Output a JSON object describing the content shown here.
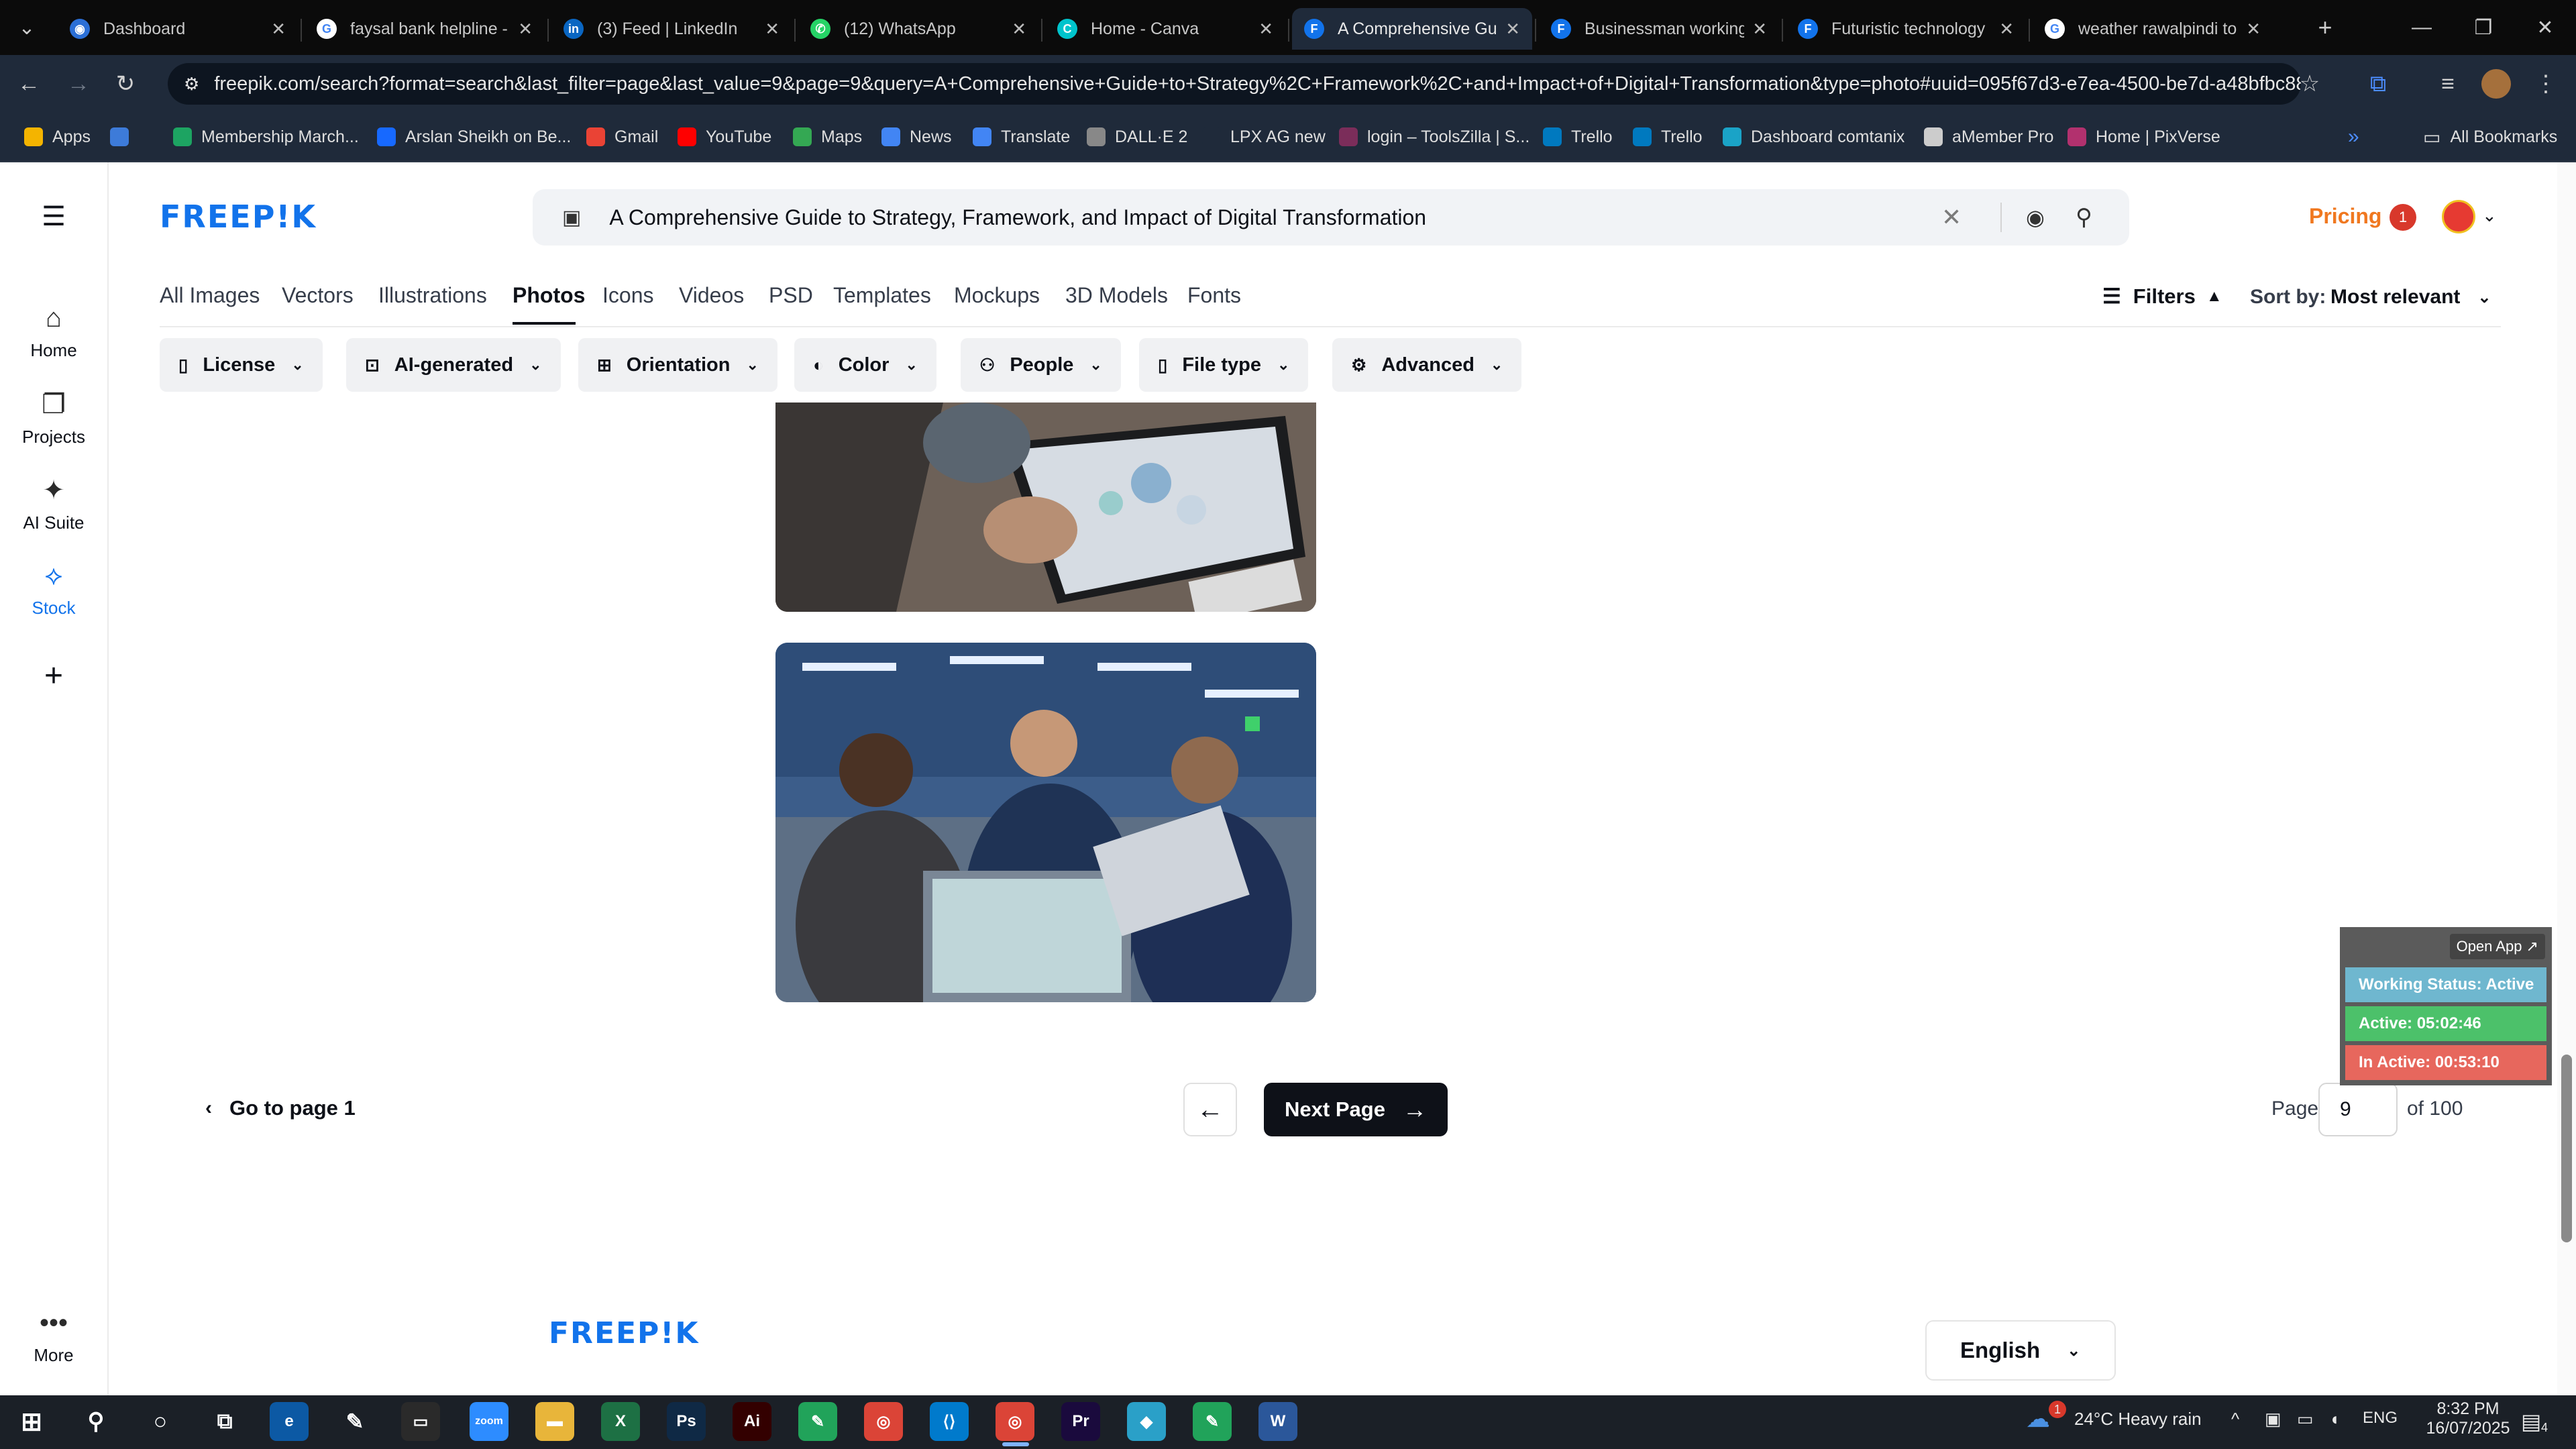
{
  "browser": {
    "tabs": [
      {
        "title": "Dashboard",
        "color": "#2b6fd6",
        "glyph": "◉"
      },
      {
        "title": "faysal bank helpline -",
        "color": "#ffffff",
        "glyph": "G"
      },
      {
        "title": "(3) Feed | LinkedIn",
        "color": "#0a66c2",
        "glyph": "in"
      },
      {
        "title": "(12) WhatsApp",
        "color": "#25d366",
        "glyph": "✆"
      },
      {
        "title": "Home - Canva",
        "color": "#00c4cc",
        "glyph": "C"
      },
      {
        "title": "A Comprehensive Gu",
        "color": "#1273eb",
        "glyph": "F"
      },
      {
        "title": "Businessman working",
        "color": "#1273eb",
        "glyph": "F"
      },
      {
        "title": "Futuristic technology",
        "color": "#1273eb",
        "glyph": "F"
      },
      {
        "title": "weather rawalpindi to",
        "color": "#ffffff",
        "glyph": "G"
      }
    ],
    "url": "freepik.com/search?format=search&last_filter=page&last_value=9&page=9&query=A+Comprehensive+Guide+to+Strategy%2C+Framework%2C+and+Impact+of+Digital+Transformation&type=photo#uuid=095f67d3-e7ea-4500-be7d-a48bfbc88e...",
    "bookmarks": [
      {
        "label": "Apps",
        "color": "#f4b400"
      },
      {
        "label": "",
        "color": "#3d7bd9"
      },
      {
        "label": "Membership March...",
        "color": "#1da462"
      },
      {
        "label": "Arslan Sheikh on Be...",
        "color": "#1769ff"
      },
      {
        "label": "Gmail",
        "color": "#ea4335"
      },
      {
        "label": "YouTube",
        "color": "#ff0000"
      },
      {
        "label": "Maps",
        "color": "#34a853"
      },
      {
        "label": "News",
        "color": "#4285f4"
      },
      {
        "label": "Translate",
        "color": "#4285f4"
      },
      {
        "label": "DALL·E 2",
        "color": "#888888"
      },
      {
        "label": "LPX AG new",
        "color": "#1f2a3a"
      },
      {
        "label": "login – ToolsZilla | S...",
        "color": "#7b2d5a"
      },
      {
        "label": "Trello",
        "color": "#0079bf"
      },
      {
        "label": "Trello",
        "color": "#0079bf"
      },
      {
        "label": "Dashboard comtanix",
        "color": "#1aa3c7"
      },
      {
        "label": "aMember Pro",
        "color": "#cccccc"
      },
      {
        "label": "Home | PixVerse",
        "color": "#b2316e"
      }
    ],
    "all_bookmarks": "All Bookmarks"
  },
  "freepik": {
    "logo": "FREEP!K",
    "rail": [
      {
        "label": "Home",
        "icon": "⌂"
      },
      {
        "label": "Projects",
        "icon": "❐"
      },
      {
        "label": "AI Suite",
        "icon": "✦"
      },
      {
        "label": "Stock",
        "icon": "⟡"
      }
    ],
    "rail_add": "+",
    "rail_more": "More",
    "search_value": "A Comprehensive Guide to Strategy, Framework, and Impact of Digital Transformation",
    "pricing": "Pricing",
    "notif_count": "1",
    "categories": [
      "All Images",
      "Vectors",
      "Illustrations",
      "Photos",
      "Icons",
      "Videos",
      "PSD",
      "Templates",
      "Mockups",
      "3D Models",
      "Fonts"
    ],
    "filters_label": "Filters",
    "sort_label": "Sort by:",
    "sort_value": "Most relevant",
    "filter_buttons": [
      "License",
      "AI-generated",
      "Orientation",
      "Color",
      "People",
      "File type",
      "Advanced"
    ],
    "go_to_page1": "Go to page 1",
    "next_page": "Next Page",
    "page_label": "Page",
    "page_value": "9",
    "page_of": "of 100",
    "language": "English",
    "footer_logo": "FREEP!K"
  },
  "widget": {
    "open_app": "Open App ↗",
    "status": "Working Status: Active",
    "active": "Active: 05:02:46",
    "inactive": "In Active: 00:53:10",
    "colors": {
      "status": "#6fb7cf",
      "active": "#4cc16a",
      "inactive": "#e7675d"
    }
  },
  "taskbar": {
    "apps": [
      {
        "name": "zoom",
        "label": "zoom",
        "color": "#2d8cff"
      },
      {
        "name": "file-explorer",
        "label": "▬",
        "color": "#e8b53a"
      },
      {
        "name": "excel",
        "label": "X",
        "color": "#1d7044"
      },
      {
        "name": "photoshop",
        "label": "Ps",
        "color": "#0f2945"
      },
      {
        "name": "illustrator",
        "label": "Ai",
        "color": "#330000"
      },
      {
        "name": "app-green-1",
        "label": "✎",
        "color": "#21a35a"
      },
      {
        "name": "chrome",
        "label": "◎",
        "color": "#db4437"
      },
      {
        "name": "vscode",
        "label": "⟨⟩",
        "color": "#007acc"
      },
      {
        "name": "chrome-active",
        "label": "◎",
        "color": "#db4437"
      },
      {
        "name": "premiere",
        "label": "Pr",
        "color": "#1a0a3d"
      },
      {
        "name": "app-blue",
        "label": "◆",
        "color": "#2aa0c8"
      },
      {
        "name": "app-green-2",
        "label": "✎",
        "color": "#21a35a"
      },
      {
        "name": "word",
        "label": "W",
        "color": "#2b579a"
      }
    ],
    "weather": "24°C  Heavy rain",
    "weather_badge": "1",
    "lang": "ENG",
    "time": "8:32 PM",
    "date": "16/07/2025",
    "notif": "4"
  }
}
